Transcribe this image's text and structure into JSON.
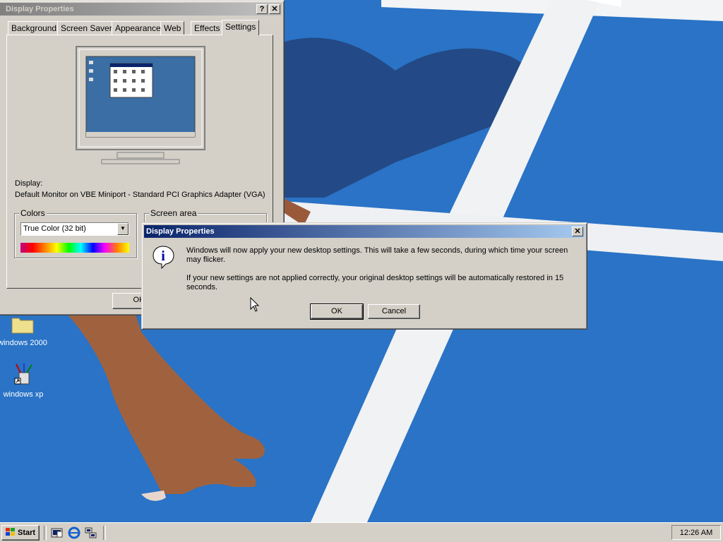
{
  "desktop": {
    "icons": [
      {
        "label": "windows 2000",
        "icon": "folder-icon"
      },
      {
        "label": "windows xp",
        "icon": "paint-cup-icon"
      }
    ]
  },
  "display_properties": {
    "title": "Display Properties",
    "tabs": [
      "Background",
      "Screen Saver",
      "Appearance",
      "Web",
      "Effects",
      "Settings"
    ],
    "selected_tab": "Settings",
    "display_label": "Display:",
    "display_value": "Default Monitor on VBE Miniport - Standard PCI Graphics Adapter (VGA)",
    "colors_group": "Colors",
    "colors_value": "True Color (32 bit)",
    "screen_area_group": "Screen area",
    "ok_label": "OK"
  },
  "dialog": {
    "title": "Display Properties",
    "message_1": "Windows will now apply your new desktop settings. This will take a few seconds, during which time your screen may flicker.",
    "message_2": "If your new settings are not applied correctly, your original desktop settings will be automatically restored in 15 seconds.",
    "ok_label": "OK",
    "cancel_label": "Cancel"
  },
  "taskbar": {
    "start_label": "Start",
    "quicklaunch": [
      "show-desktop-icon",
      "internet-explorer-icon",
      "network-icon"
    ],
    "clock": "12:26 AM"
  },
  "colors": {
    "title_active": "#0a246a",
    "title_inactive": "#808080",
    "face": "#d4d0c8",
    "wallpaper": "#2a74c4"
  }
}
